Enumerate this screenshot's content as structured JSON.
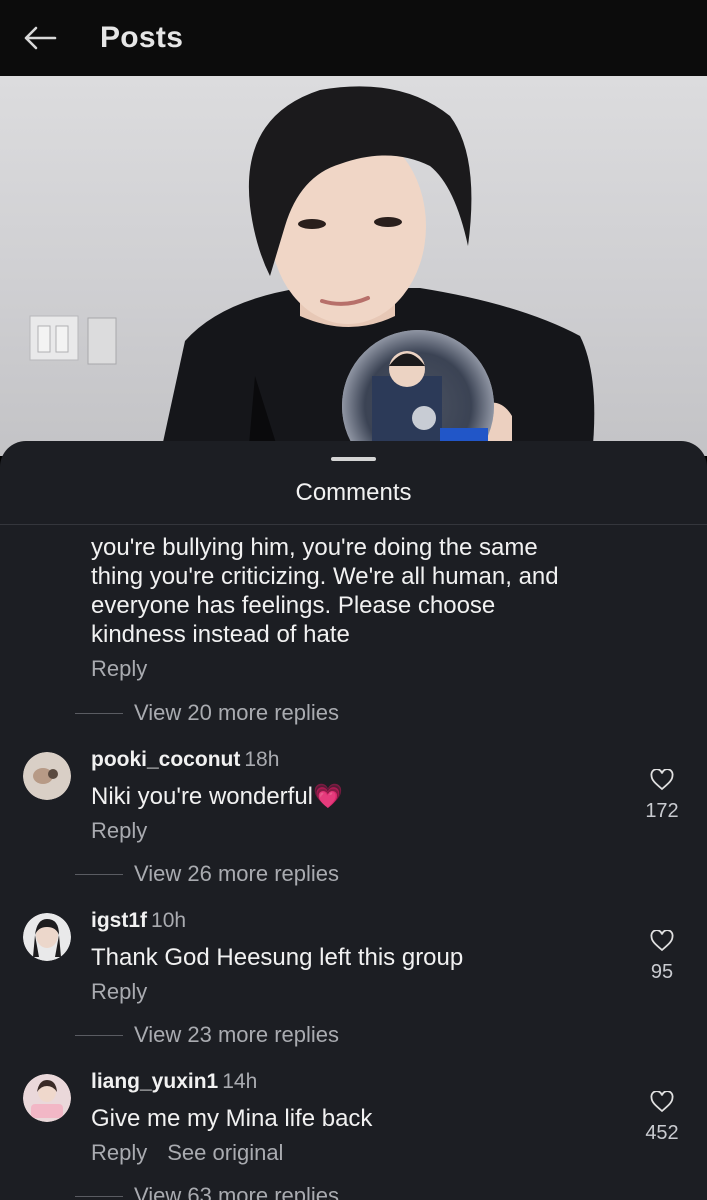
{
  "header": {
    "title": "Posts"
  },
  "sheet": {
    "title": "Comments"
  },
  "partial_comment": {
    "text_lines": [
      "you're bullying him, you're doing the same",
      "thing you're criticizing. We're all human, and",
      "everyone has feelings. Please choose",
      "kindness instead of hate"
    ],
    "reply": "Reply",
    "view_replies": "View 20 more replies"
  },
  "comments": [
    {
      "username": "pooki_coconut",
      "time": "18h",
      "text": "Niki you're wonderful💗",
      "reply": "Reply",
      "likes": "172",
      "view_replies": "View 26 more replies"
    },
    {
      "username": "igst1f",
      "time": "10h",
      "text": "Thank God Heesung left this group",
      "reply": "Reply",
      "likes": "95",
      "view_replies": "View 23 more replies"
    },
    {
      "username": "liang_yuxin1",
      "time": "14h",
      "text": "Give me my Mina life back",
      "reply": "Reply",
      "see_original": "See original",
      "likes": "452",
      "view_replies": "View 63 more replies"
    }
  ],
  "icons": {
    "back": "arrow-left-icon",
    "like": "heart-outline-icon"
  },
  "colors": {
    "sheet_bg": "#1c1e23",
    "topbar_bg": "#0c0c0c",
    "muted_text": "#a9abb0"
  }
}
